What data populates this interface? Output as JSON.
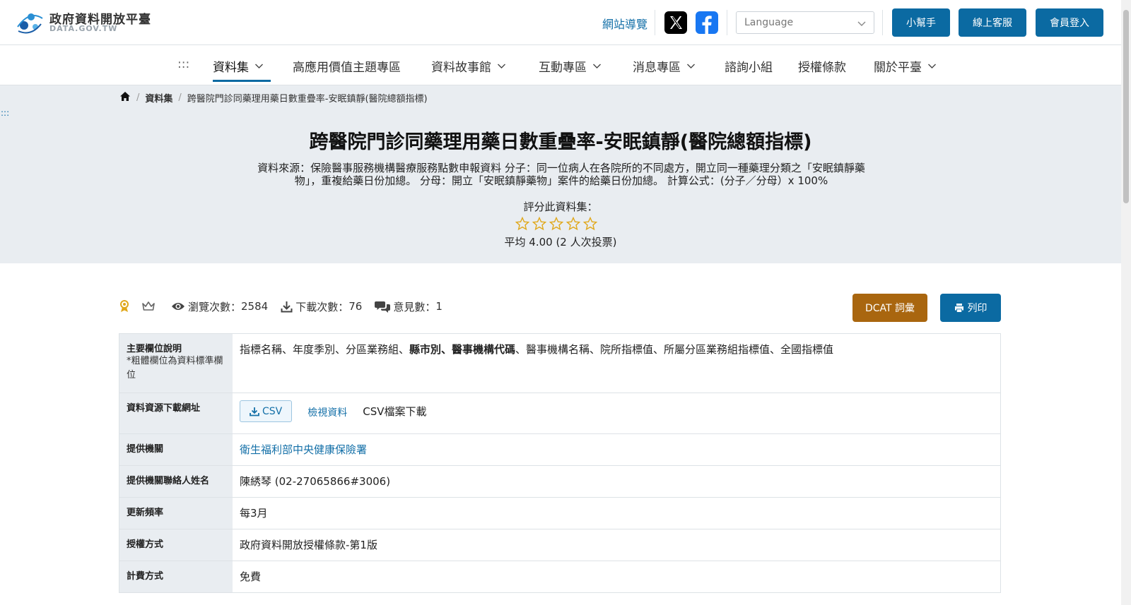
{
  "header": {
    "logo_title": "政府資料開放平臺",
    "logo_sub": "DATA.GOV.TW",
    "sitemap": "網站導覽",
    "language_placeholder": "Language",
    "buttons": {
      "helper": "小幫手",
      "support": "線上客服",
      "login": "會員登入"
    }
  },
  "nav": {
    "skip": ":::",
    "items": [
      "資料集",
      "高應用價值主題專區",
      "資料故事館",
      "互動專區",
      "消息專區",
      "諮詢小組",
      "授權條款",
      "關於平臺"
    ]
  },
  "breadcrumb": {
    "items": [
      "資料集",
      "跨醫院門診同藥理用藥日數重疊率-安眠鎮靜(醫院總額指標)"
    ]
  },
  "hero": {
    "skip": ":::",
    "title": "跨醫院門診同藥理用藥日數重疊率-安眠鎮靜(醫院總額指標)",
    "description": "資料來源：保險醫事服務機構醫療服務點數申報資料 分子：同一位病人在各院所的不同處方，開立同一種藥理分類之「安眠鎮靜藥物」，重複給藥日份加總。 分母：開立「安眠鎮靜藥物」案件的給藥日份加總。 計算公式：(分子／分母）x 100%",
    "rate_label": "評分此資料集：",
    "rating": {
      "average": 4.0,
      "max": 5
    },
    "average_text": "平均 4.00 (2 人次投票)"
  },
  "stats": {
    "views_label": "瀏覽次數：",
    "views": "2584",
    "downloads_label": "下載次數：",
    "downloads": "76",
    "comments_label": "意見數：",
    "comments": "1",
    "dcat_button": "DCAT 詞彙",
    "print_button": "列印"
  },
  "table": {
    "fields_label": "主要欄位說明",
    "fields_note": "*粗體欄位為資料標準欄位",
    "fields_before": "指標名稱、年度季別、分區業務組、",
    "fields_bold": "縣市別、醫事機構代碼",
    "fields_after": "、醫事機構名稱、院所指標值、所屬分區業務組指標值、全國指標值",
    "resource_label": "資料資源下載網址",
    "csv_button": "CSV",
    "view_data": "檢視資料",
    "csv_desc": "CSV檔案下載",
    "provider_label": "提供機關",
    "provider": "衛生福利部中央健康保險署",
    "contact_label": "提供機關聯絡人姓名",
    "contact": "陳綉琴 (02-27065866#3006)",
    "frequency_label": "更新頻率",
    "frequency": "每3月",
    "license_label": "授權方式",
    "license": "政府資料開放授權條款-第1版",
    "fee_label": "計費方式",
    "fee": "免費"
  },
  "colors": {
    "primary": "#0b6aa2",
    "accent": "#a9660f",
    "star": "#e0a81c",
    "hero_bg": "#e9edf1"
  }
}
